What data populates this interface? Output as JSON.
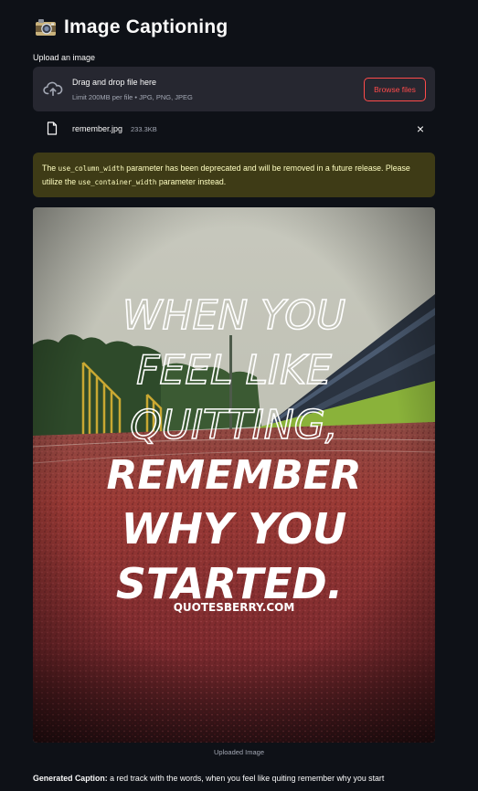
{
  "app": {
    "title": "Image Captioning",
    "title_icon": "camera-icon"
  },
  "uploader": {
    "label": "Upload an image",
    "drop_title": "Drag and drop file here",
    "drop_limit": "Limit 200MB per file • JPG, PNG, JPEG",
    "browse_label": "Browse files",
    "file_name": "remember.jpg",
    "file_size": "233.3KB"
  },
  "warning": {
    "p1": "The ",
    "code1": "use_column_width",
    "p2": " parameter has been deprecated and will be removed in a future release. Please utilize the ",
    "code2": "use_container_width",
    "p3": " parameter instead."
  },
  "image": {
    "line1": "WHEN YOU",
    "line2": "FEEL LIKE",
    "line3": "QUITTING,",
    "line4": "REMEMBER",
    "line5": "WHY YOU",
    "line6": "STARTED.",
    "credit": "QUOTESBERRY.COM",
    "caption": "Uploaded Image"
  },
  "result": {
    "label": "Generated Caption:",
    "text": " a red track with the words, when you feel like quiting remember why you start"
  },
  "colors": {
    "background": "#0e1117",
    "accent": "#ff4b4b",
    "warning_bg": "#3e3b16",
    "warning_text": "#ffffc2"
  }
}
